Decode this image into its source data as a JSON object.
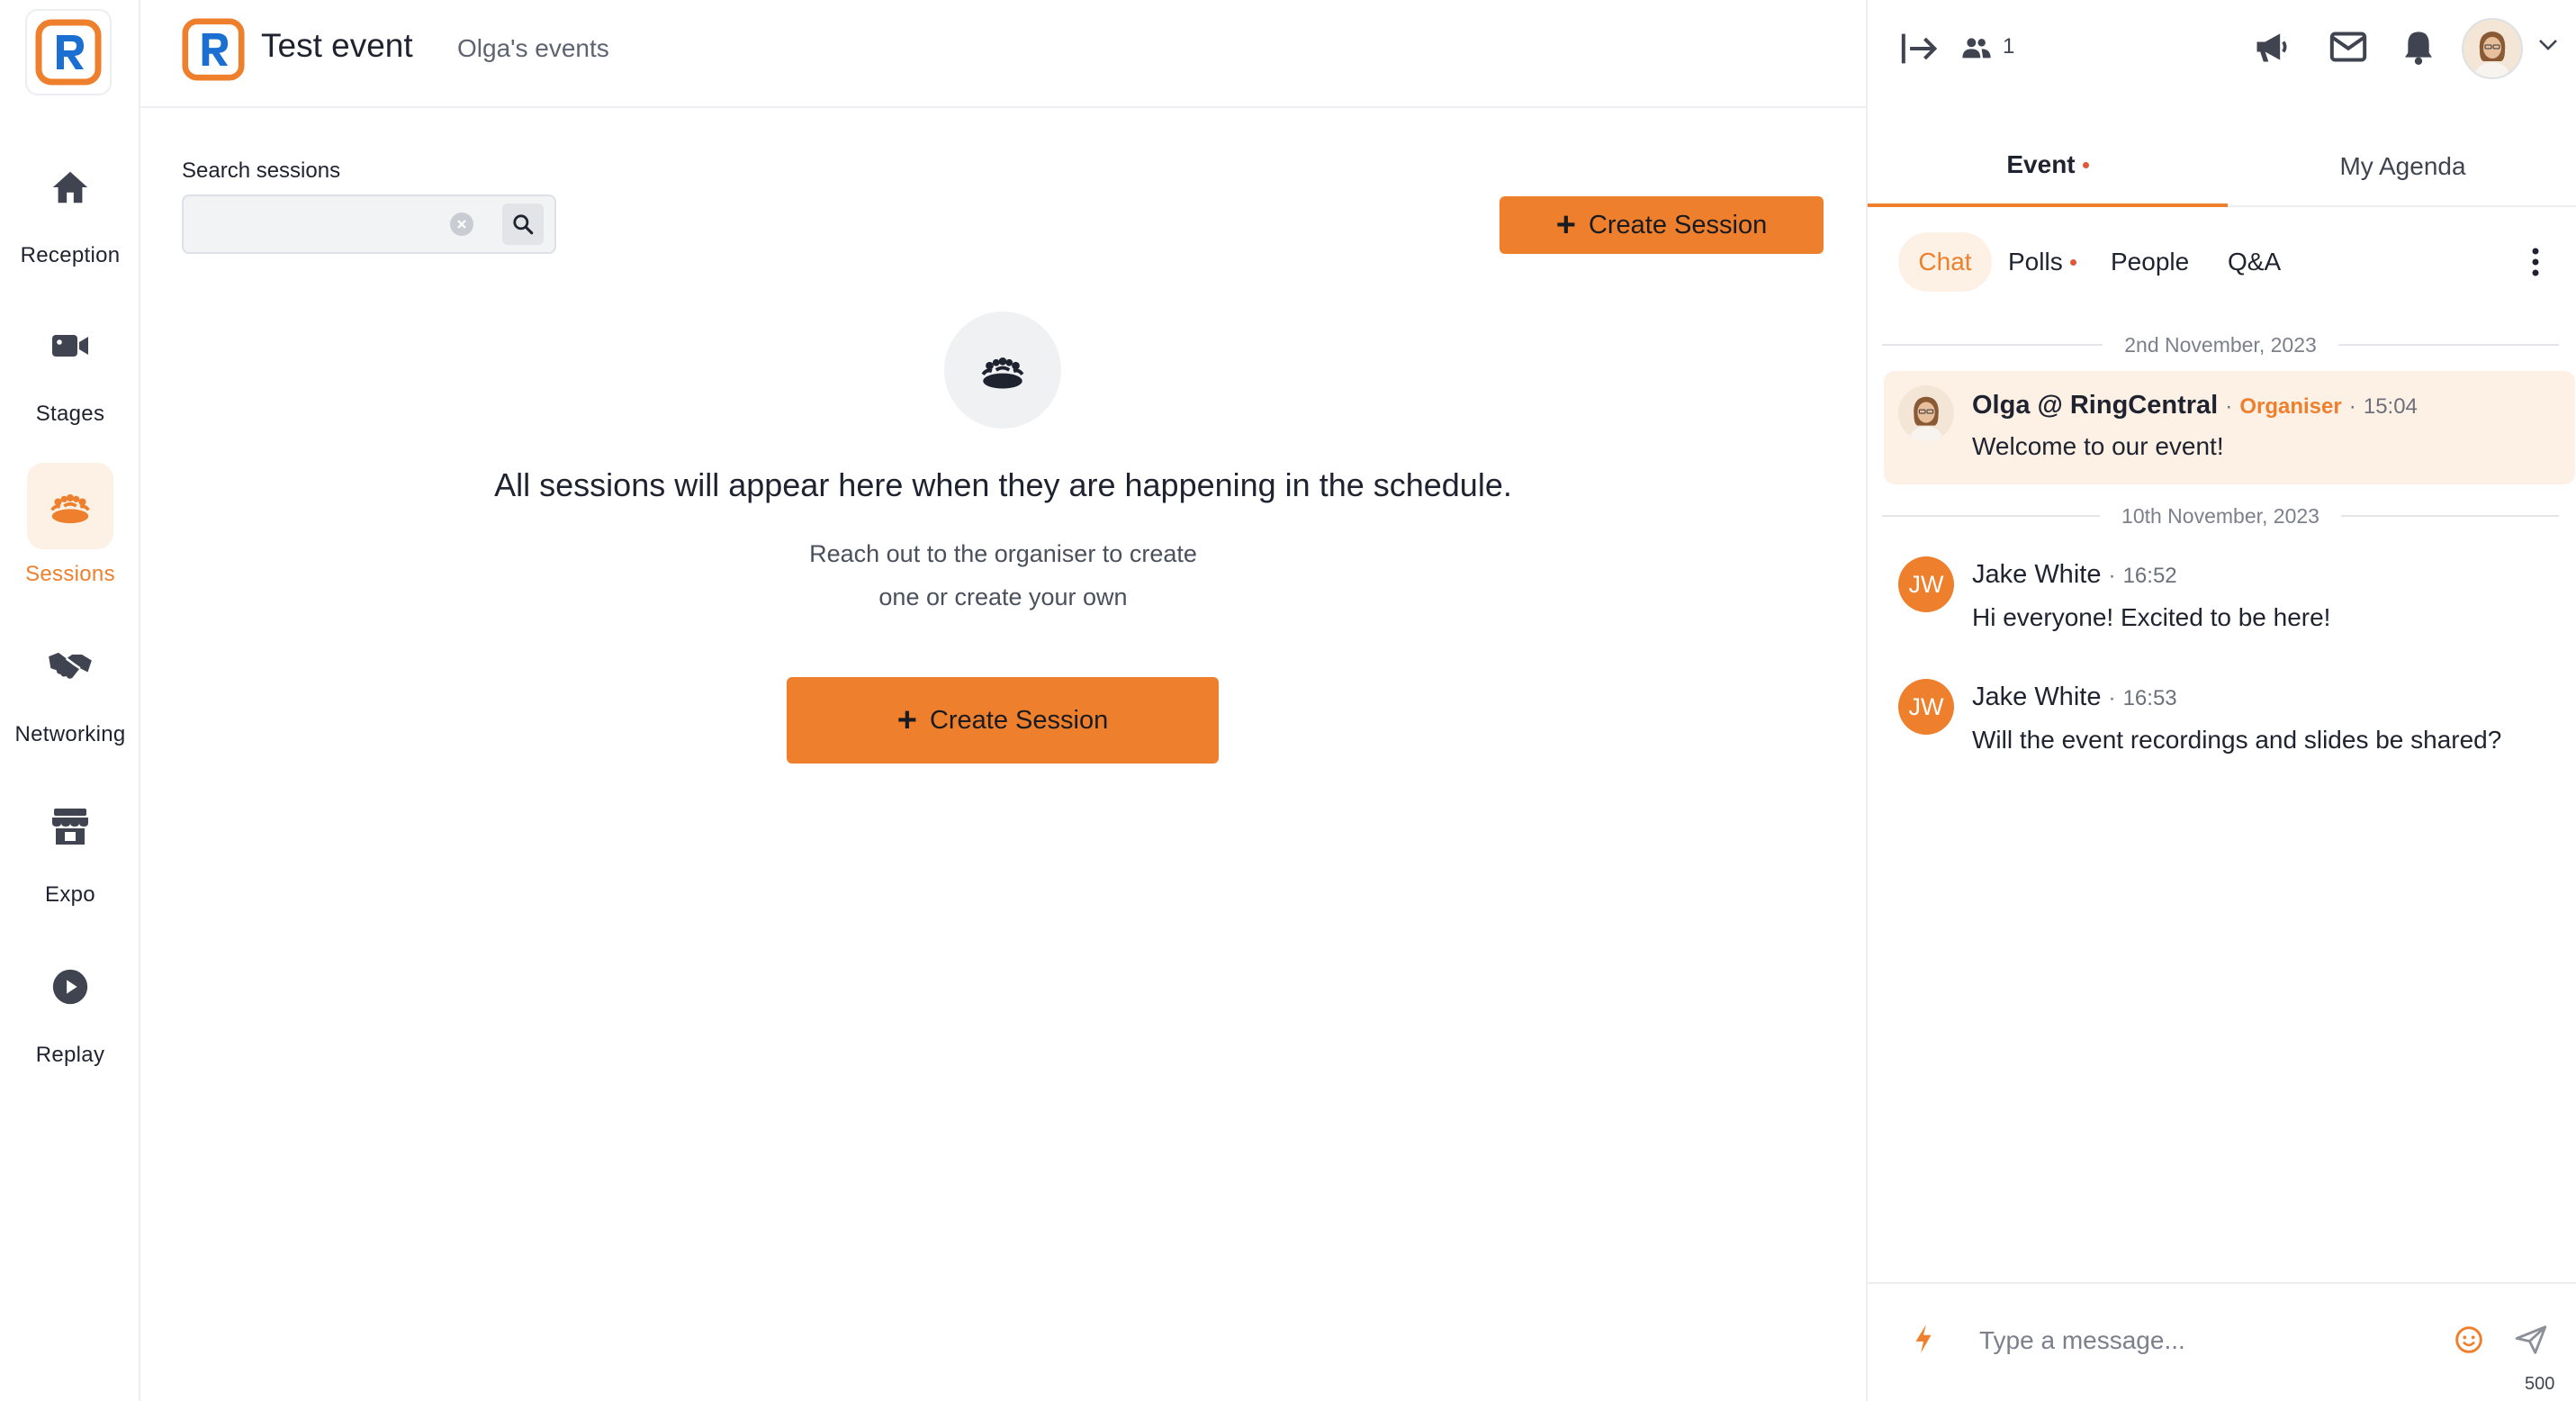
{
  "colors": {
    "accent": "#ee7f2d",
    "accent_soft": "#fdf1e6",
    "text": "#1f2330",
    "muted": "#6b707b",
    "brand_blue": "#1a6fd1"
  },
  "nav": {
    "items": [
      {
        "label": "Reception",
        "icon": "home-icon"
      },
      {
        "label": "Stages",
        "icon": "video-camera-icon"
      },
      {
        "label": "Sessions",
        "icon": "sessions-icon",
        "active": true
      },
      {
        "label": "Networking",
        "icon": "handshake-icon"
      },
      {
        "label": "Expo",
        "icon": "store-icon"
      },
      {
        "label": "Replay",
        "icon": "play-circle-icon"
      }
    ]
  },
  "header": {
    "event_title": "Test event",
    "owner": "Olga's events"
  },
  "main": {
    "search": {
      "label": "Search sessions",
      "value": "",
      "placeholder": ""
    },
    "create_button_label": "Create Session",
    "empty_state": {
      "title": "All sessions will appear here when they are happening in the schedule.",
      "subtitle_line1": "Reach out to the organiser to create",
      "subtitle_line2": "one or create your own",
      "button_label": "Create Session"
    }
  },
  "right_panel": {
    "attendee_count": "1",
    "tabs": {
      "event": "Event",
      "agenda": "My Agenda"
    },
    "subtabs": {
      "chat": "Chat",
      "polls": "Polls",
      "people": "People",
      "qa": "Q&A"
    },
    "chat": {
      "date_1": "2nd November, 2023",
      "date_2": "10th November, 2023",
      "messages": [
        {
          "author": "Olga @ RingCentral",
          "role": "Organiser",
          "sep": "·",
          "time": "15:04",
          "text": "Welcome to our event!"
        },
        {
          "author": "Jake White",
          "initials": "JW",
          "sep": "·",
          "time": "16:52",
          "text": "Hi everyone! Excited to be here!"
        },
        {
          "author": "Jake White",
          "initials": "JW",
          "sep": "·",
          "time": "16:53",
          "text": "Will the event recordings and slides be shared?"
        }
      ]
    },
    "composer": {
      "placeholder": "Type a message...",
      "char_count": "500"
    }
  }
}
